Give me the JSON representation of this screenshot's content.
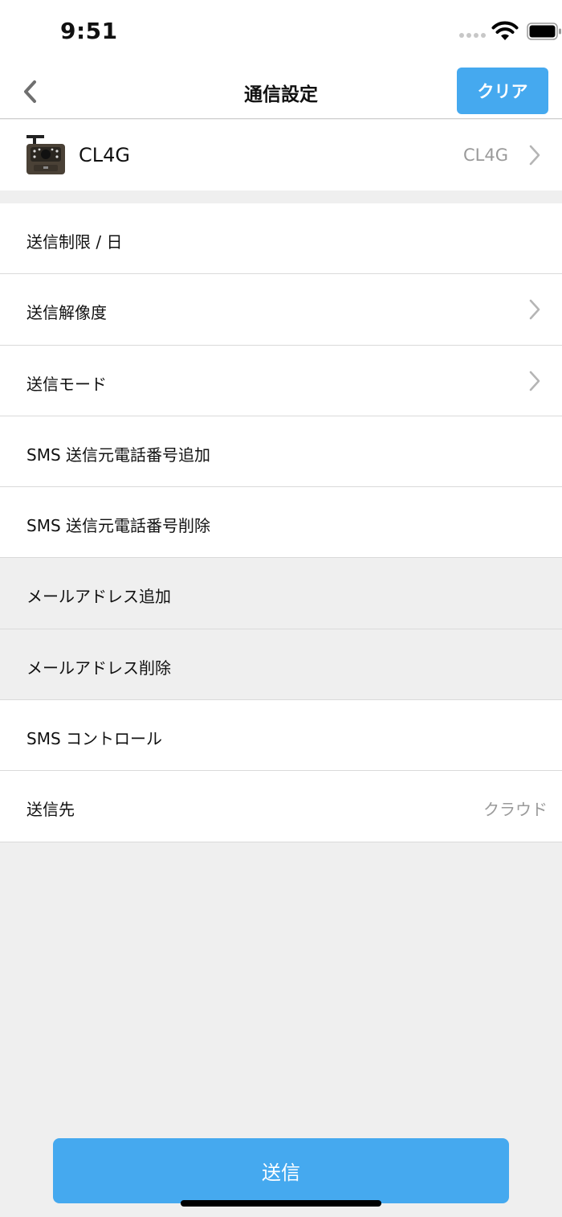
{
  "status_bar": {
    "time": "9:51"
  },
  "nav": {
    "title": "通信設定",
    "clear_label": "クリア"
  },
  "device": {
    "name": "CL4G",
    "value": "CL4G"
  },
  "settings": [
    {
      "label": "送信制限 / 日",
      "value": "",
      "chevron": false,
      "dim": false
    },
    {
      "label": "送信解像度",
      "value": "",
      "chevron": true,
      "dim": false
    },
    {
      "label": "送信モード",
      "value": "",
      "chevron": true,
      "dim": false
    },
    {
      "label": "SMS 送信元電話番号追加",
      "value": "",
      "chevron": false,
      "dim": false
    },
    {
      "label": "SMS 送信元電話番号削除",
      "value": "",
      "chevron": false,
      "dim": false
    },
    {
      "label": "メールアドレス追加",
      "value": "",
      "chevron": false,
      "dim": true
    },
    {
      "label": "メールアドレス削除",
      "value": "",
      "chevron": false,
      "dim": true
    },
    {
      "label": "SMS コントロール",
      "value": "",
      "chevron": false,
      "dim": false
    },
    {
      "label": "送信先",
      "value": "クラウド",
      "chevron": false,
      "dim": false
    }
  ],
  "footer": {
    "send_label": "送信"
  },
  "colors": {
    "accent": "#45a9ef",
    "secondary_text": "#9a9a9a",
    "background": "#efefef"
  }
}
